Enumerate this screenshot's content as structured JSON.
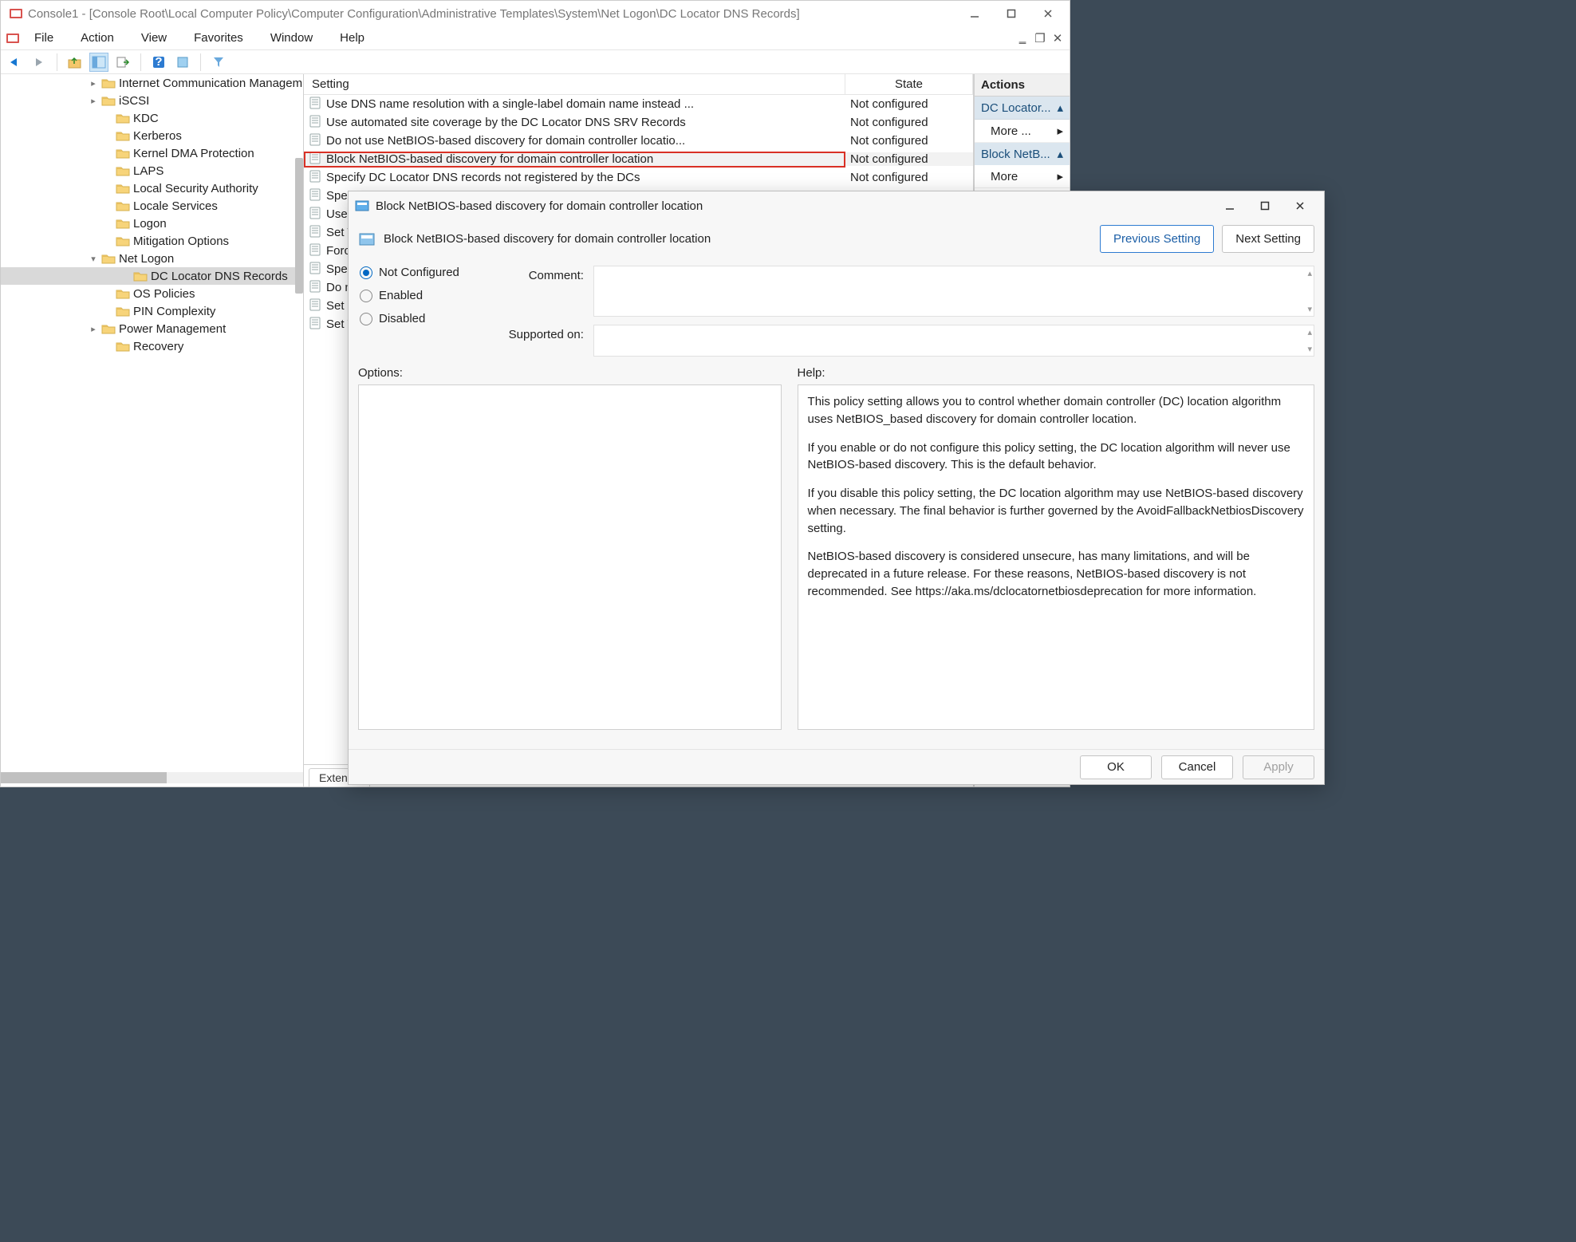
{
  "window": {
    "title": "Console1 - [Console Root\\Local Computer Policy\\Computer Configuration\\Administrative Templates\\System\\Net Logon\\DC Locator DNS Records]"
  },
  "menu": {
    "items": [
      "File",
      "Action",
      "View",
      "Favorites",
      "Window",
      "Help"
    ]
  },
  "tree": {
    "items": [
      {
        "label": "Internet Communication Managem",
        "indent": 110,
        "expander": ">"
      },
      {
        "label": "iSCSI",
        "indent": 110,
        "expander": ">"
      },
      {
        "label": "KDC",
        "indent": 128,
        "expander": ""
      },
      {
        "label": "Kerberos",
        "indent": 128,
        "expander": ""
      },
      {
        "label": "Kernel DMA Protection",
        "indent": 128,
        "expander": ""
      },
      {
        "label": "LAPS",
        "indent": 128,
        "expander": ""
      },
      {
        "label": "Local Security Authority",
        "indent": 128,
        "expander": ""
      },
      {
        "label": "Locale Services",
        "indent": 128,
        "expander": ""
      },
      {
        "label": "Logon",
        "indent": 128,
        "expander": ""
      },
      {
        "label": "Mitigation Options",
        "indent": 128,
        "expander": ""
      },
      {
        "label": "Net Logon",
        "indent": 110,
        "expander": "v",
        "expanded": true
      },
      {
        "label": "DC Locator DNS Records",
        "indent": 150,
        "expander": "",
        "selected": true
      },
      {
        "label": "OS Policies",
        "indent": 128,
        "expander": ""
      },
      {
        "label": "PIN Complexity",
        "indent": 128,
        "expander": ""
      },
      {
        "label": "Power Management",
        "indent": 110,
        "expander": ">"
      },
      {
        "label": "Recovery",
        "indent": 128,
        "expander": ""
      }
    ]
  },
  "list": {
    "columns": {
      "setting": "Setting",
      "state": "State"
    },
    "rows": [
      {
        "setting": "Use DNS name resolution with a single-label domain name instead ...",
        "state": "Not configured"
      },
      {
        "setting": "Use automated site coverage by the DC Locator DNS SRV Records",
        "state": "Not configured"
      },
      {
        "setting": "Do not use NetBIOS-based discovery for domain controller locatio...",
        "state": "Not configured"
      },
      {
        "setting": "Block NetBIOS-based discovery for domain controller location",
        "state": "Not configured",
        "highlighted": true,
        "redbox": true
      },
      {
        "setting": "Specify DC Locator DNS records not registered by the DCs",
        "state": "Not configured"
      },
      {
        "setting": "Spec",
        "state": ""
      },
      {
        "setting": "Use",
        "state": ""
      },
      {
        "setting": "Set T",
        "state": ""
      },
      {
        "setting": "Forc",
        "state": ""
      },
      {
        "setting": "Spec",
        "state": ""
      },
      {
        "setting": "Do n",
        "state": ""
      },
      {
        "setting": "Set P",
        "state": ""
      },
      {
        "setting": "Set V",
        "state": ""
      }
    ],
    "tab": "Extende"
  },
  "actions": {
    "header": "Actions",
    "group1": "DC Locator...",
    "more": "More ...",
    "group2": "Block NetB...",
    "more2": "More"
  },
  "dialog": {
    "title": "Block NetBIOS-based discovery for domain controller location",
    "subtitle": "Block NetBIOS-based discovery for domain controller location",
    "prev": "Previous Setting",
    "next": "Next Setting",
    "radios": {
      "nc": "Not Configured",
      "en": "Enabled",
      "dis": "Disabled"
    },
    "labels": {
      "comment": "Comment:",
      "supported": "Supported on:",
      "options": "Options:",
      "help": "Help:"
    },
    "help_text": "This policy setting allows you to control whether domain controller (DC) location algorithm uses NetBIOS_based discovery for domain controller location.\n\nIf you enable or do not configure this policy setting, the DC location algorithm will never use NetBIOS-based discovery. This is the default behavior.\n\nIf you disable this policy setting, the DC location algorithm may use NetBIOS-based discovery when necessary. The final behavior is further governed by the AvoidFallbackNetbiosDiscovery setting.\n\nNetBIOS-based discovery is considered unsecure, has many limitations, and will be deprecated in a future release. For these reasons, NetBIOS-based discovery is not recommended. See https://aka.ms/dclocatornetbiosdeprecation for more information.",
    "footer": {
      "ok": "OK",
      "cancel": "Cancel",
      "apply": "Apply"
    }
  }
}
